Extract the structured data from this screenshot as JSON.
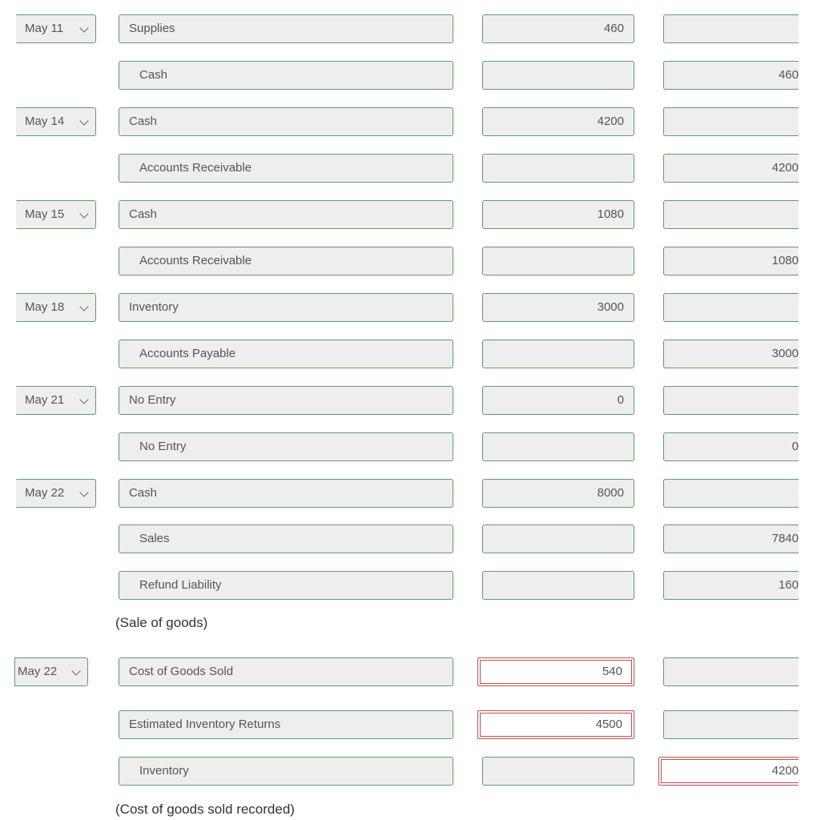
{
  "colors": {
    "valid_border": "#5e9e62",
    "error_border": "#c0504d",
    "field_bg": "#eeeeee"
  },
  "icons": {
    "date_dropdown": "chevron-down-icon"
  },
  "sections": [
    {
      "rows": [
        {
          "date": "May 11",
          "account": "Supplies",
          "debit": "460",
          "credit": ""
        },
        {
          "account": "Cash",
          "debit": "",
          "credit": "460",
          "indent": true
        },
        {
          "date": "May 14",
          "account": "Cash",
          "debit": "4200",
          "credit": ""
        },
        {
          "account": "Accounts Receivable",
          "debit": "",
          "credit": "4200",
          "indent": true
        },
        {
          "date": "May 15",
          "account": "Cash",
          "debit": "1080",
          "credit": ""
        },
        {
          "account": "Accounts Receivable",
          "debit": "",
          "credit": "1080",
          "indent": true
        },
        {
          "date": "May 18",
          "account": "Inventory",
          "debit": "3000",
          "credit": ""
        },
        {
          "account": "Accounts Payable",
          "debit": "",
          "credit": "3000",
          "indent": true
        },
        {
          "date": "May 21",
          "account": "No Entry",
          "debit": "0",
          "credit": ""
        },
        {
          "account": "No Entry",
          "debit": "",
          "credit": "0",
          "indent": true
        },
        {
          "date": "May 22",
          "account": "Cash",
          "debit": "8000",
          "credit": ""
        },
        {
          "account": "Sales",
          "debit": "",
          "credit": "7840",
          "indent": true
        },
        {
          "account": "Refund Liability",
          "debit": "",
          "credit": "160",
          "indent": true
        }
      ],
      "note": "(Sale of goods)"
    },
    {
      "rows": [
        {
          "date": "May 22",
          "account": "Cost of Goods Sold",
          "debit": "540",
          "credit": "",
          "debit_error": true
        },
        {
          "account": "Estimated Inventory Returns",
          "debit": "4500",
          "credit": "",
          "debit_error": true
        },
        {
          "account": "Inventory",
          "debit": "",
          "credit": "4200",
          "indent": true,
          "credit_error": true
        }
      ],
      "note": "(Cost of goods sold recorded)"
    }
  ]
}
